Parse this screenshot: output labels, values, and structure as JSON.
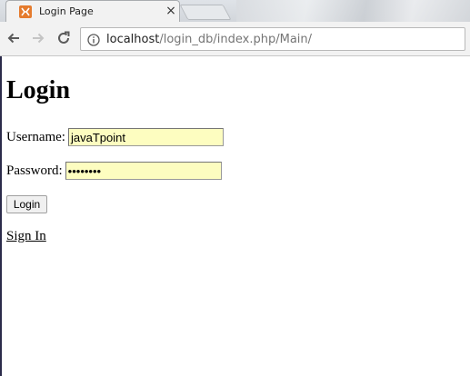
{
  "tab": {
    "title": "Login Page",
    "close_glyph": "×",
    "favicon_icon": "xampp-icon"
  },
  "toolbar": {
    "back_icon": "back-arrow-icon",
    "forward_icon": "forward-arrow-icon",
    "reload_icon": "reload-icon",
    "info_icon": "info-icon",
    "url_host": "localhost",
    "url_path": "/login_db/index.php/Main/"
  },
  "page": {
    "heading": "Login",
    "username_label": "Username:",
    "username_value": "javaTpoint",
    "password_label": "Password:",
    "password_value": "••••••••",
    "login_button": "Login",
    "signin_link": "Sign In"
  },
  "colors": {
    "autofill_bg": "#fdfdc0",
    "favicon": "#e57b2d"
  }
}
